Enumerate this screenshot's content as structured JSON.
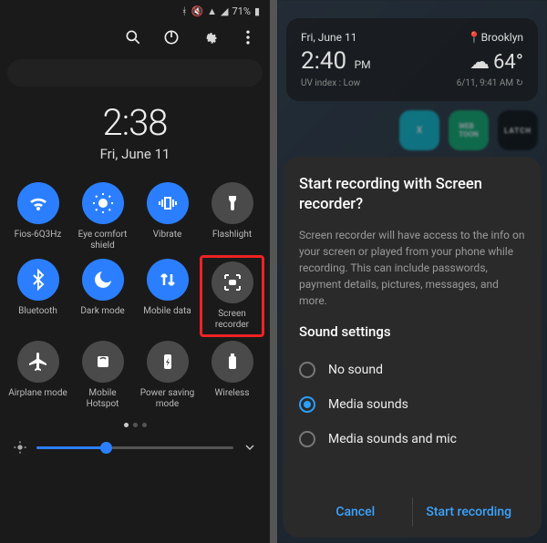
{
  "left": {
    "status": {
      "battery": "71%"
    },
    "clock": {
      "time": "2:38",
      "date": "Fri, June 11"
    },
    "tiles": [
      {
        "key": "wifi",
        "label": "Fios-6Q3Hz",
        "on": true
      },
      {
        "key": "eyecomfort",
        "label": "Eye comfort shield",
        "on": true
      },
      {
        "key": "vibrate",
        "label": "Vibrate",
        "on": true
      },
      {
        "key": "flashlight",
        "label": "Flashlight",
        "on": false
      },
      {
        "key": "bluetooth",
        "label": "Bluetooth",
        "on": true
      },
      {
        "key": "darkmode",
        "label": "Dark mode",
        "on": true
      },
      {
        "key": "mobiledata",
        "label": "Mobile data",
        "on": true
      },
      {
        "key": "screenrec",
        "label": "Screen recorder",
        "on": false,
        "highlight": true
      },
      {
        "key": "airplane",
        "label": "Airplane mode",
        "on": false
      },
      {
        "key": "hotspot",
        "label": "Mobile Hotspot",
        "on": false
      },
      {
        "key": "powersave",
        "label": "Power saving mode",
        "on": false
      },
      {
        "key": "wireless",
        "label": "Wireless",
        "on": false
      }
    ],
    "brightness": {
      "percent": 35
    }
  },
  "right": {
    "weather": {
      "date": "Fri, June 11",
      "location": "Brooklyn",
      "time": "2:40",
      "ampm": "PM",
      "temp": "64°",
      "uv": "UV index : Low",
      "updated": "6/11, 9:41 AM ↻"
    },
    "dialog": {
      "title": "Start recording with Screen recorder?",
      "body": "Screen recorder will have access to the info on your screen or played from your phone while recording. This can include passwords, payment details, pictures, messages, and more.",
      "sound_title": "Sound settings",
      "options": [
        {
          "key": "none",
          "label": "No sound"
        },
        {
          "key": "media",
          "label": "Media sounds",
          "selected": true
        },
        {
          "key": "mic",
          "label": "Media sounds and mic"
        }
      ],
      "cancel": "Cancel",
      "start": "Start recording"
    }
  }
}
